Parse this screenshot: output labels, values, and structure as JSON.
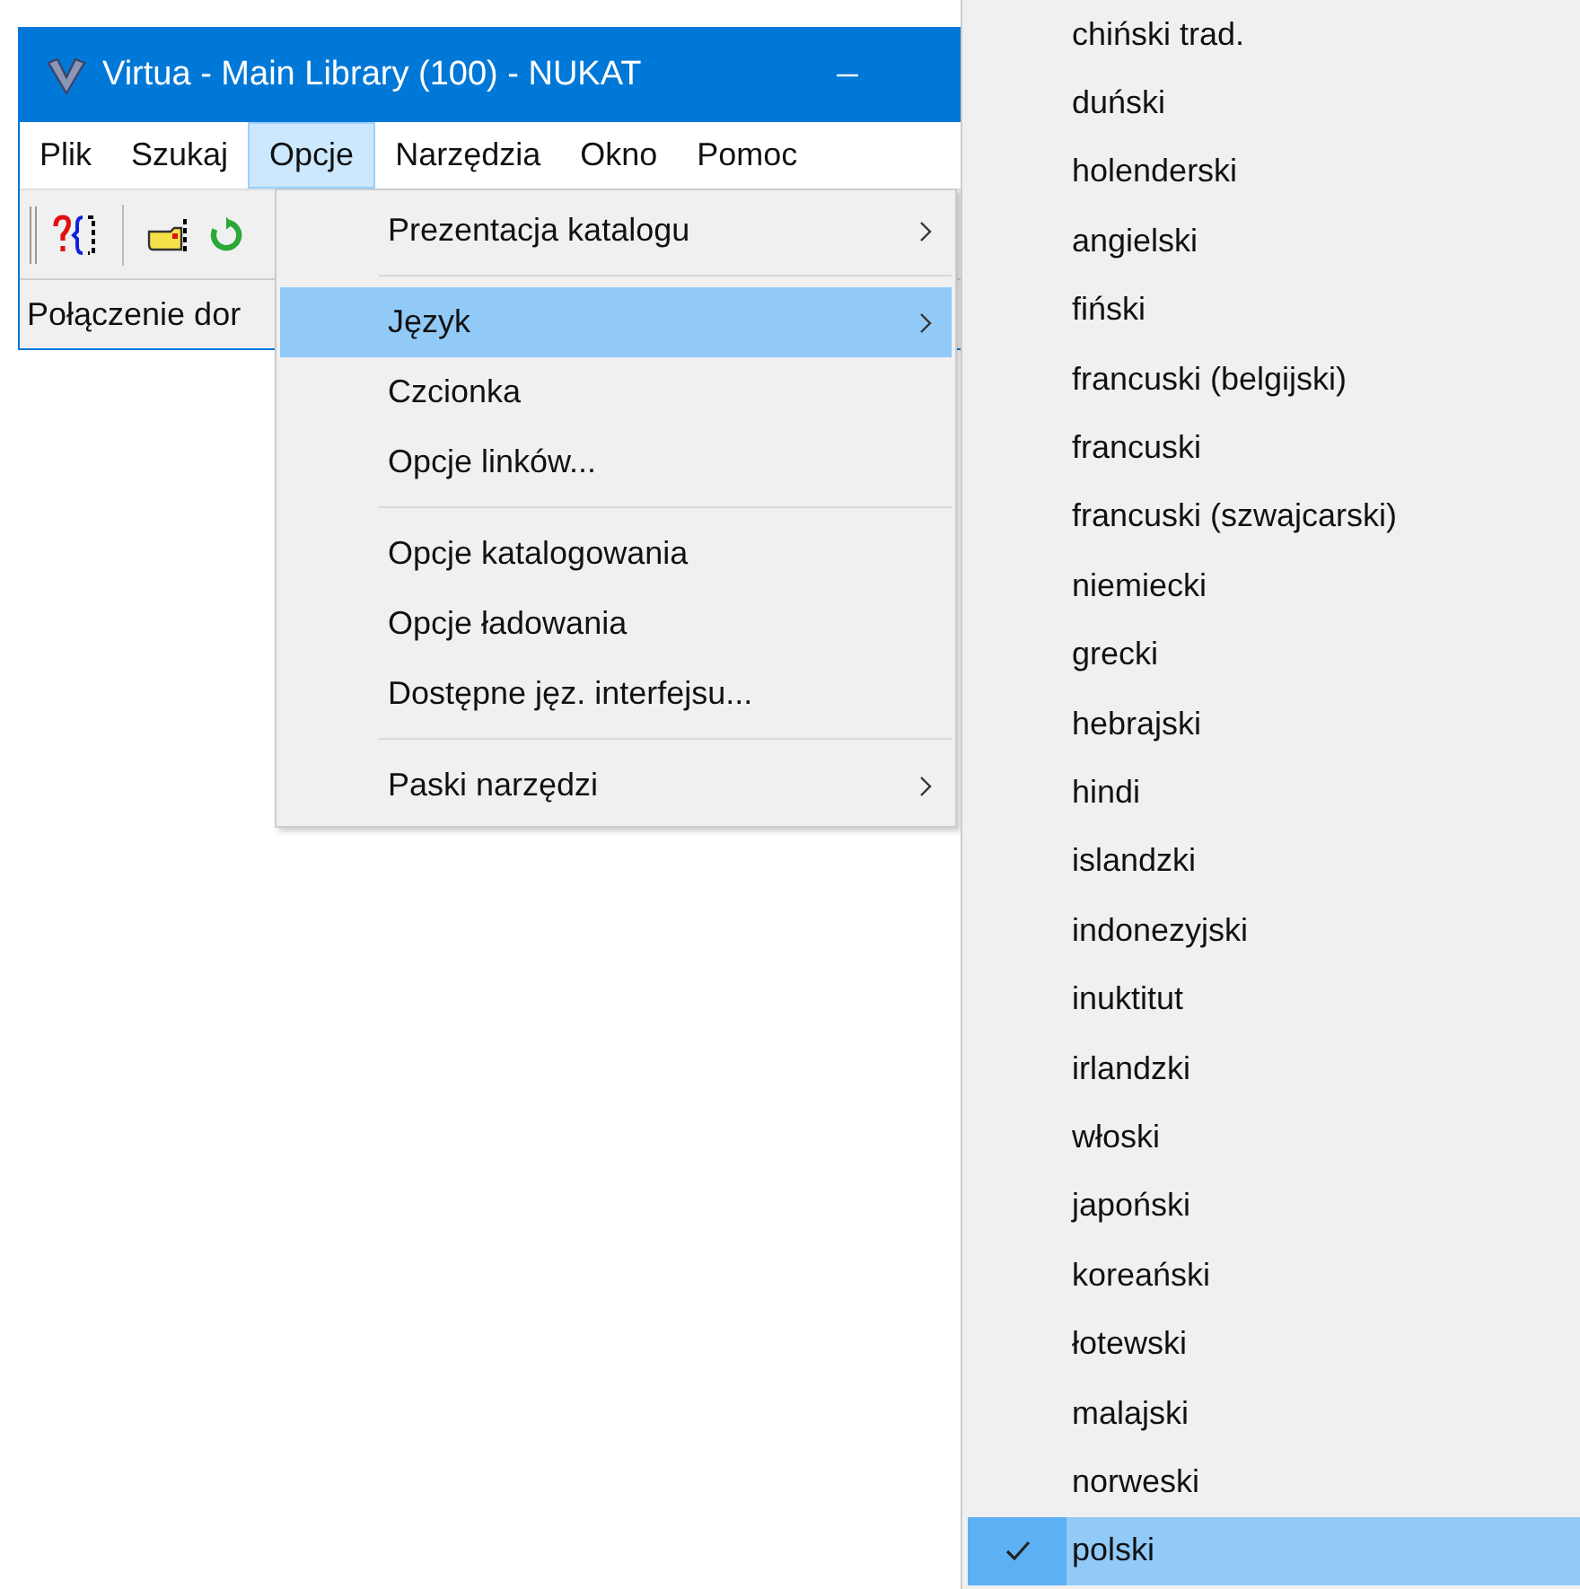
{
  "window": {
    "title": "Virtua - Main Library (100) - NUKAT"
  },
  "menu_bar": [
    {
      "label": "Plik",
      "selected": false
    },
    {
      "label": "Szukaj",
      "selected": false
    },
    {
      "label": "Opcje",
      "selected": true
    },
    {
      "label": "Narzędzia",
      "selected": false
    },
    {
      "label": "Okno",
      "selected": false
    },
    {
      "label": "Pomoc",
      "selected": false
    }
  ],
  "status_bar": {
    "text": "Połączenie dor"
  },
  "options_menu": [
    {
      "kind": "item",
      "label": "Prezentacja katalogu",
      "submenu": true,
      "selected": false
    },
    {
      "kind": "separator"
    },
    {
      "kind": "item",
      "label": "Język",
      "submenu": true,
      "selected": true
    },
    {
      "kind": "item",
      "label": "Czcionka",
      "submenu": false,
      "selected": false
    },
    {
      "kind": "item",
      "label": "Opcje linków...",
      "submenu": false,
      "selected": false
    },
    {
      "kind": "separator"
    },
    {
      "kind": "item",
      "label": "Opcje katalogowania",
      "submenu": false,
      "selected": false
    },
    {
      "kind": "item",
      "label": "Opcje ładowania",
      "submenu": false,
      "selected": false
    },
    {
      "kind": "item",
      "label": "Dostępne jęz. interfejsu...",
      "submenu": false,
      "selected": false
    },
    {
      "kind": "separator"
    },
    {
      "kind": "item",
      "label": "Paski narzędzi",
      "submenu": true,
      "selected": false
    }
  ],
  "language_submenu": [
    {
      "label": "chiński trad.",
      "checked": false,
      "selected": false
    },
    {
      "label": "duński",
      "checked": false,
      "selected": false
    },
    {
      "label": "holenderski",
      "checked": false,
      "selected": false
    },
    {
      "label": "angielski",
      "checked": false,
      "selected": false
    },
    {
      "label": "fiński",
      "checked": false,
      "selected": false
    },
    {
      "label": "francuski (belgijski)",
      "checked": false,
      "selected": false
    },
    {
      "label": "francuski",
      "checked": false,
      "selected": false
    },
    {
      "label": "francuski (szwajcarski)",
      "checked": false,
      "selected": false
    },
    {
      "label": "niemiecki",
      "checked": false,
      "selected": false
    },
    {
      "label": "grecki",
      "checked": false,
      "selected": false
    },
    {
      "label": "hebrajski",
      "checked": false,
      "selected": false
    },
    {
      "label": "hindi",
      "checked": false,
      "selected": false
    },
    {
      "label": "islandzki",
      "checked": false,
      "selected": false
    },
    {
      "label": "indonezyjski",
      "checked": false,
      "selected": false
    },
    {
      "label": "inuktitut",
      "checked": false,
      "selected": false
    },
    {
      "label": "irlandzki",
      "checked": false,
      "selected": false
    },
    {
      "label": "włoski",
      "checked": false,
      "selected": false
    },
    {
      "label": "japoński",
      "checked": false,
      "selected": false
    },
    {
      "label": "koreański",
      "checked": false,
      "selected": false
    },
    {
      "label": "łotewski",
      "checked": false,
      "selected": false
    },
    {
      "label": "malajski",
      "checked": false,
      "selected": false
    },
    {
      "label": "norweski",
      "checked": false,
      "selected": false
    },
    {
      "label": "polski",
      "checked": true,
      "selected": true
    }
  ]
}
